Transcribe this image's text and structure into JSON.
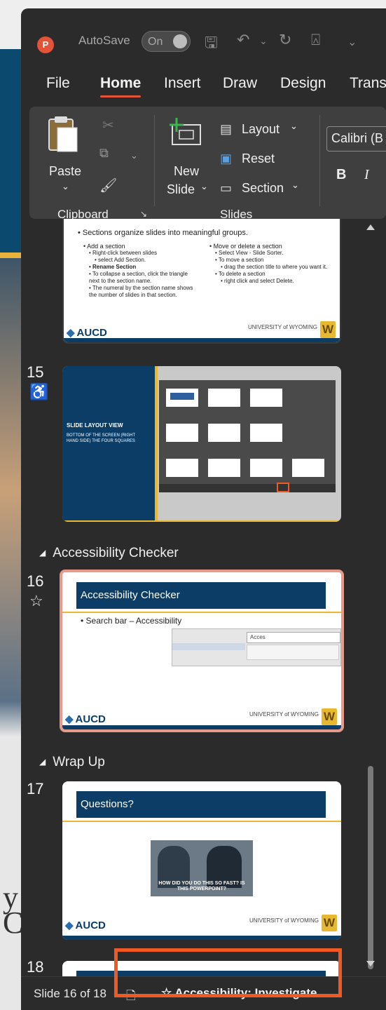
{
  "background": {
    "text": "y\nC"
  },
  "titlebar": {
    "logo": "P",
    "autosave_label": "AutoSave",
    "toggle_state": "On"
  },
  "tabs": [
    "File",
    "Home",
    "Insert",
    "Draw",
    "Design",
    "Trans"
  ],
  "ribbon": {
    "paste": "Paste",
    "clipboard_group": "Clipboard",
    "new_slide_1": "New",
    "new_slide_2": "Slide",
    "layout": "Layout",
    "reset": "Reset",
    "section": "Section",
    "slides_group": "Slides",
    "font_name": "Calibri (B",
    "bold": "B",
    "italic": "I"
  },
  "slide14": {
    "intro": "• Sections organize slides into meaningful groups.",
    "left_col": [
      "• Add a section",
      "• Right-click between slides",
      "• select Add Section.",
      "• Rename Section",
      "• To collapse a section, click the triangle next to the section name.",
      "• The numeral by the section name shows the number of slides in that section."
    ],
    "right_col": [
      "• Move or delete a section",
      "• Select View - Slide Sorter.",
      "• To move a section",
      "• drag the section title to where you want it.",
      "• To delete a section",
      "• right click and select Delete."
    ],
    "aucd": "AUCD",
    "uw": "UNIVERSITY of WYOMING"
  },
  "slide15": {
    "number": "15",
    "title": "SLIDE LAYOUT VIEW",
    "subtitle": "BOTTOM OF THE SCREEN (RIGHT HAND SIDE) THE FOUR SQUARES"
  },
  "section_accessibility": "Accessibility Checker",
  "slide16": {
    "number": "16",
    "title": "Accessibility Checker",
    "bullet": "• Search bar – Accessibility",
    "search_text": "Acces",
    "aucd": "AUCD"
  },
  "section_wrap": "Wrap Up",
  "slide17": {
    "number": "17",
    "title": "Questions?",
    "meme_caption": "HOW DID YOU DO THIS SO FAST? IS THIS POWERPOINT?",
    "aucd": "AUCD"
  },
  "slide18": {
    "number": "18"
  },
  "statusbar": {
    "slide_info": "Slide 16 of 18",
    "accessibility": "Accessibility: Investigate"
  },
  "colors": {
    "accent": "#e2533a",
    "highlight": "#f05a22",
    "slide_navy": "#0b3d66",
    "slide_gold": "#e8b930"
  }
}
